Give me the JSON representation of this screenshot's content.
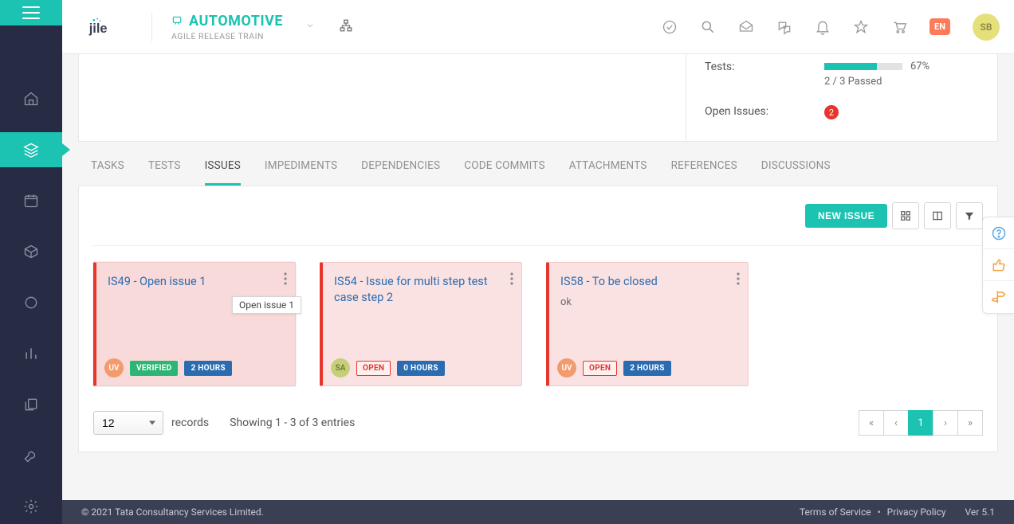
{
  "header": {
    "project_name": "AUTOMOTIVE",
    "project_sub": "AGILE RELEASE TRAIN",
    "lang": "EN",
    "user_initials": "SB"
  },
  "summary": {
    "tests_label": "Tests:",
    "tests_pct": "67%",
    "tests_sub": "2 / 3 Passed",
    "open_issues_label": "Open Issues:",
    "open_issues_count": "2"
  },
  "tabs": [
    {
      "label": "TASKS"
    },
    {
      "label": "TESTS"
    },
    {
      "label": "ISSUES",
      "active": true
    },
    {
      "label": "IMPEDIMENTS"
    },
    {
      "label": "DEPENDENCIES"
    },
    {
      "label": "CODE COMMITS"
    },
    {
      "label": "ATTACHMENTS"
    },
    {
      "label": "REFERENCES"
    },
    {
      "label": "DISCUSSIONS"
    }
  ],
  "issues": {
    "new_button": "NEW ISSUE",
    "cards": [
      {
        "title": "IS49 - Open issue 1",
        "desc": "",
        "tooltip": "Open issue 1",
        "avatar": "UV",
        "avatar_class": "av-orange",
        "status": "VERIFIED",
        "status_class": "chip-verified",
        "hours": "2 HOURS"
      },
      {
        "title": "IS54 - Issue for multi step test case step 2",
        "desc": "",
        "avatar": "SA",
        "avatar_class": "av-olive",
        "status": "OPEN",
        "status_class": "chip-open",
        "hours": "0 HOURS"
      },
      {
        "title": "IS58 - To be closed",
        "desc": "ok",
        "avatar": "UV",
        "avatar_class": "av-orange",
        "status": "OPEN",
        "status_class": "chip-open",
        "hours": "2 HOURS"
      }
    ],
    "page_size": "12",
    "records_label": "records",
    "showing": "Showing 1 - 3 of 3 entries",
    "page": "1"
  },
  "footer": {
    "copyright": "© 2021 Tata Consultancy Services Limited.",
    "tos": "Terms of Service",
    "privacy": "Privacy Policy",
    "version": "Ver 5.1"
  }
}
